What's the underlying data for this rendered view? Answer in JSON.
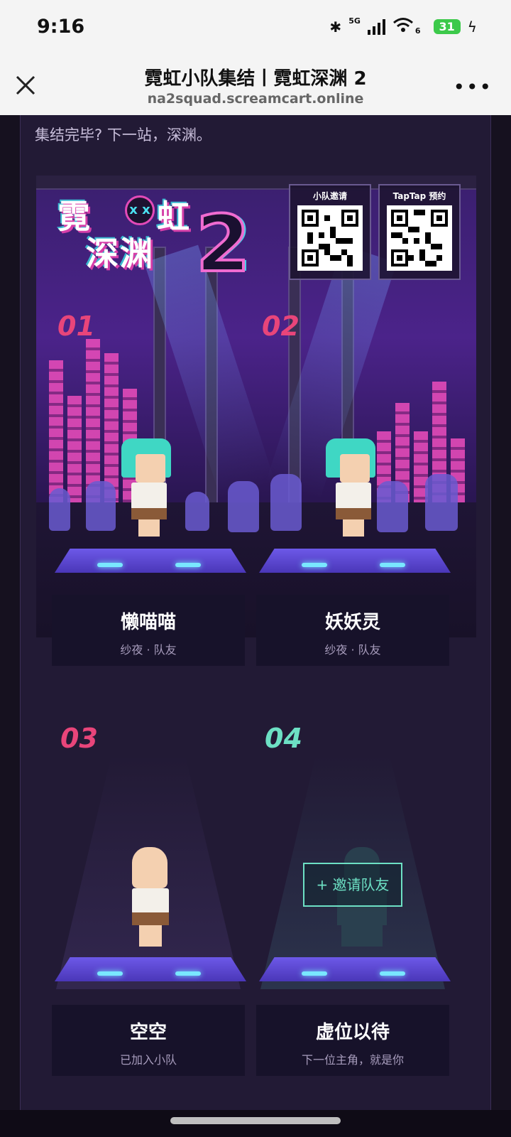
{
  "status_bar": {
    "time": "9:16",
    "network": "5G",
    "wifi_tag": "6",
    "battery": "31",
    "icons": [
      "bluetooth-icon",
      "signal-icon",
      "wifi-icon",
      "battery-icon",
      "charging-icon"
    ]
  },
  "nav": {
    "title": "霓虹小队集结丨霓虹深渊 2",
    "url": "na2squad.screamcart.online",
    "close_icon": "close-icon",
    "more_icon": "more-icon"
  },
  "page": {
    "subtitle": "集结完毕? 下一站，深渊。"
  },
  "banner": {
    "logo_line1": "霓",
    "logo_line1b": "虹",
    "logo_line2": "深渊",
    "logo_number": "2",
    "qr_codes": [
      {
        "label": "小队邀请"
      },
      {
        "label": "TapTap 预约"
      }
    ]
  },
  "slots": [
    {
      "number": "01",
      "name": "懒喵喵",
      "role": "纱夜 · 队友",
      "number_color": "#e8457a"
    },
    {
      "number": "02",
      "name": "妖妖灵",
      "role": "纱夜 · 队友",
      "number_color": "#e8457a"
    },
    {
      "number": "03",
      "name": "空空",
      "role": "已加入小队",
      "number_color": "#e8457a"
    },
    {
      "number": "04",
      "name": "虚位以待",
      "role": "下一位主角，就是你",
      "number_color": "#6de0c4",
      "invite_label": "+ 邀请队友"
    }
  ],
  "colors": {
    "accent_pink": "#e8457a",
    "accent_teal": "#6de0c4",
    "background": "#221a35"
  }
}
